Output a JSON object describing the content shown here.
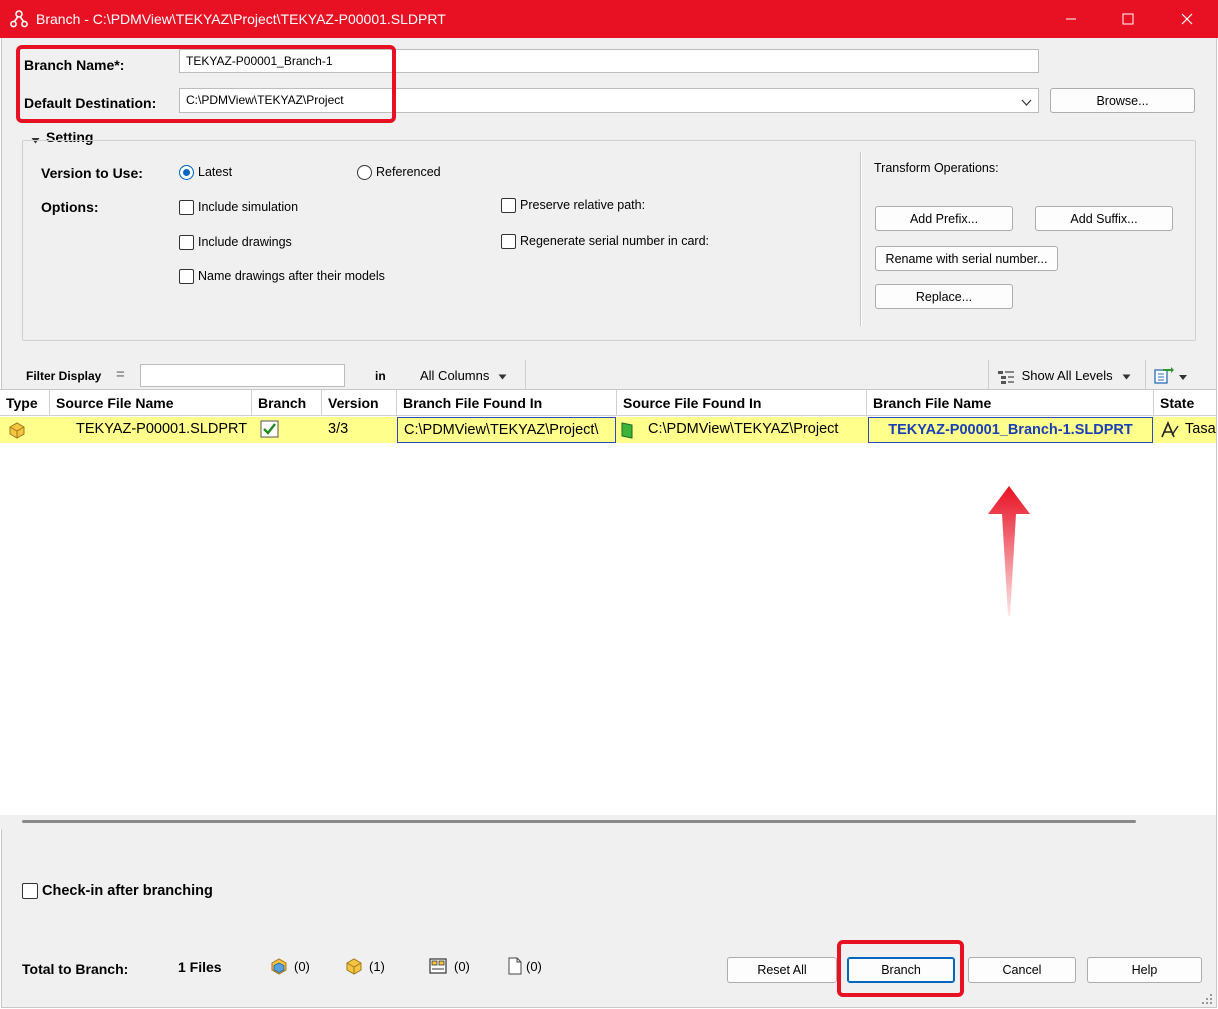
{
  "window": {
    "title": "Branch - C:\\PDMView\\TEKYAZ\\Project\\TEKYAZ-P00001.SLDPRT"
  },
  "branch_name": {
    "label": "Branch Name*:",
    "value": "TEKYAZ-P00001_Branch-1"
  },
  "destination": {
    "label": "Default Destination:",
    "value": "C:\\PDMView\\TEKYAZ\\Project",
    "browse_label": "Browse..."
  },
  "setting": {
    "header": "Setting",
    "version_label": "Version to Use:",
    "version_latest": "Latest",
    "version_referenced": "Referenced",
    "options_label": "Options:",
    "include_simulation": "Include simulation",
    "include_drawings": "Include drawings",
    "name_drawings": "Name drawings after their models",
    "preserve_paths": "Preserve relative path:",
    "regenerate_serial": "Regenerate serial number in card:",
    "transform_label": "Transform Operations:",
    "add_prefix": "Add Prefix...",
    "add_suffix": "Add Suffix...",
    "rename_serial": "Rename with serial number...",
    "replace": "Replace..."
  },
  "filter": {
    "label": "Filter Display",
    "equals": "=",
    "in_label": "in",
    "columns": "All Columns",
    "levels": "Show All Levels"
  },
  "grid": {
    "columns": [
      "Type",
      "Source File Name",
      "Branch",
      "Version",
      "Branch File Found In",
      "Source File Found In",
      "Branch File Name",
      "State"
    ],
    "rows": [
      {
        "source_file_name": "TEKYAZ-P00001.SLDPRT",
        "version": "3/3",
        "branch_found_in": "C:\\PDMView\\TEKYAZ\\Project\\",
        "source_found_in": "C:\\PDMView\\TEKYAZ\\Project",
        "branch_file_name": "TEKYAZ-P00001_Branch-1.SLDPRT",
        "state": "Tasar"
      }
    ]
  },
  "checkin_label": "Check-in after branching",
  "totals": {
    "label": "Total to Branch:",
    "files": "1 Files",
    "assemblies": "(0)",
    "parts": "(1)",
    "drawings": "(0)",
    "other": "(0)"
  },
  "buttons": {
    "reset_all": "Reset All",
    "branch": "Branch",
    "cancel": "Cancel",
    "help": "Help"
  },
  "colors": {
    "titlebar": "#e81123",
    "highlight_row": "#ffff8c",
    "annotation_red": "#e81123",
    "link_blue": "#1a3fb5"
  }
}
